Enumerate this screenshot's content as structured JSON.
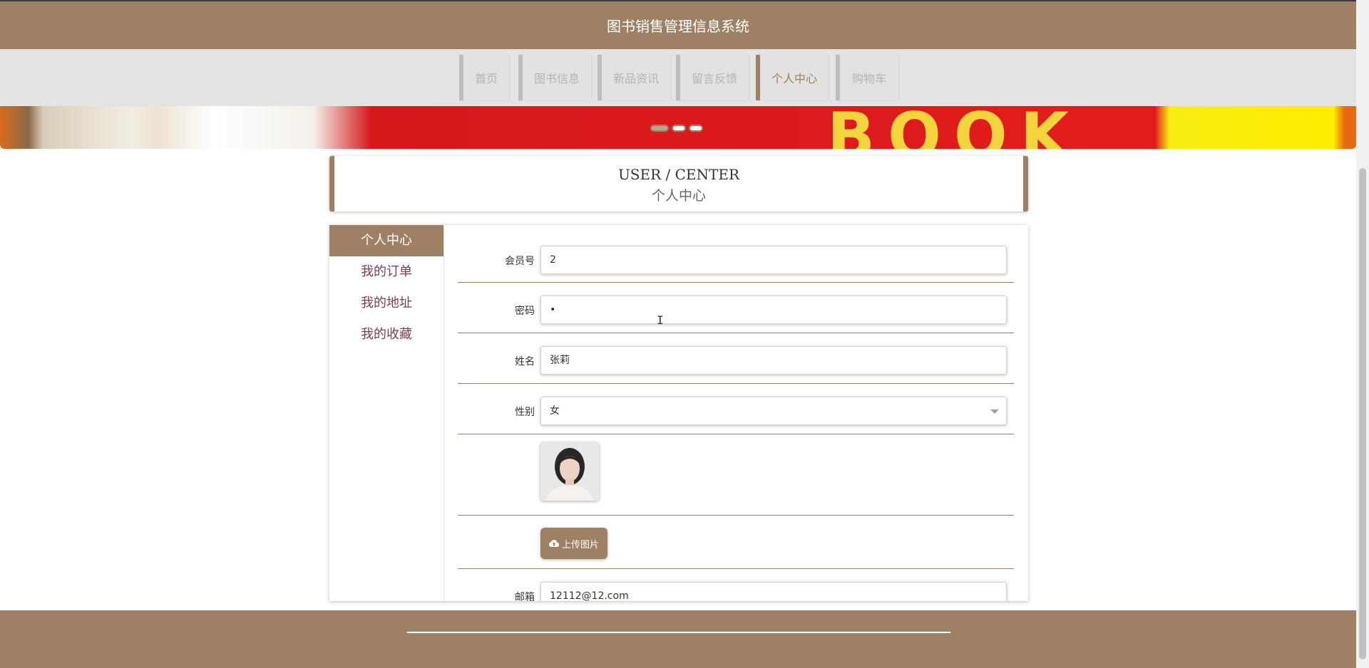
{
  "app": {
    "title": "图书销售管理信息系统"
  },
  "nav": {
    "items": [
      {
        "label": "首页"
      },
      {
        "label": "图书信息"
      },
      {
        "label": "新品资讯"
      },
      {
        "label": "留言反馈"
      },
      {
        "label": "个人中心"
      },
      {
        "label": "购物车"
      }
    ],
    "active_index": 4
  },
  "banner": {
    "text": "BOOK",
    "active_dot": 1,
    "dot_count": 3
  },
  "section": {
    "title_en": "USER / CENTER",
    "title_cn": "个人中心"
  },
  "sidebar": {
    "items": [
      {
        "label": "个人中心"
      },
      {
        "label": "我的订单"
      },
      {
        "label": "我的地址"
      },
      {
        "label": "我的收藏"
      }
    ],
    "active_index": 0
  },
  "form": {
    "member_no": {
      "label": "会员号",
      "value": "2"
    },
    "password": {
      "label": "密码",
      "value": "•"
    },
    "name": {
      "label": "姓名",
      "value": "张莉"
    },
    "gender": {
      "label": "性别",
      "value": "女"
    },
    "upload": {
      "label": "上传图片"
    },
    "email": {
      "label": "邮箱",
      "value": "12112@12.com"
    }
  },
  "colors": {
    "brand": "#9e8064",
    "nav_bg": "#e4e4e4",
    "sidebar_text": "#7a3e50"
  }
}
